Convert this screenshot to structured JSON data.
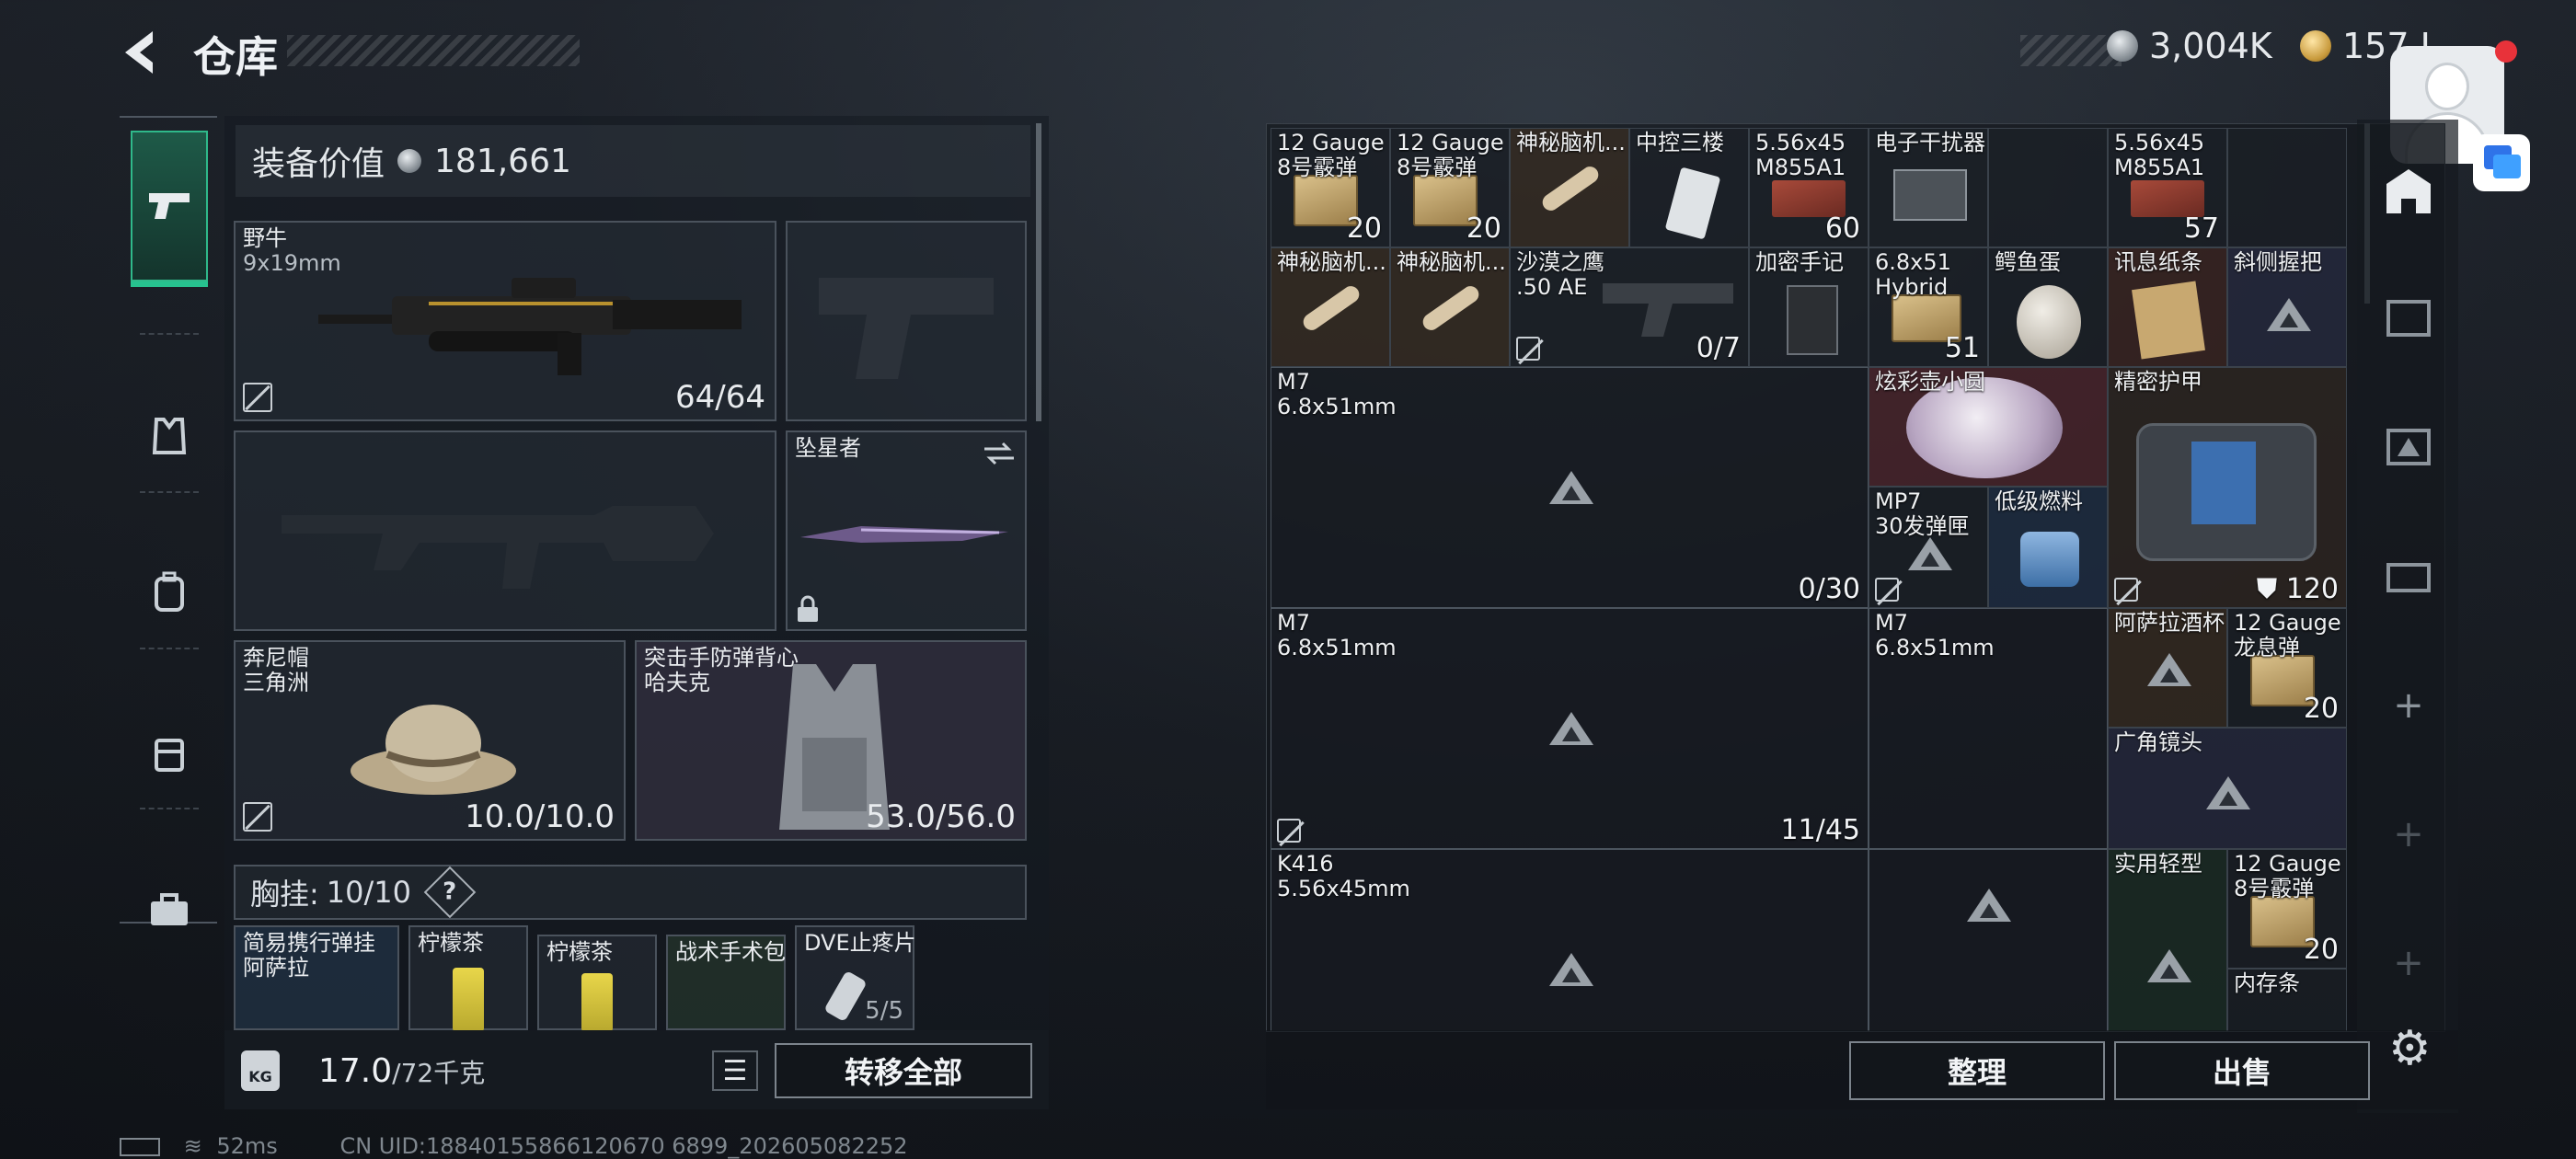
{
  "header": {
    "title": "仓库",
    "silver": "3,004K",
    "gold": "157 I"
  },
  "equipment": {
    "value_label": "装备价值",
    "value": "181,661",
    "primary": {
      "name": "野牛",
      "caliber": "9x19mm",
      "ammo": "64/64"
    },
    "melee": {
      "name": "坠星者"
    },
    "helmet": {
      "name": "奔尼帽\n三角洲",
      "durability": "10.0/10.0"
    },
    "armor": {
      "name": "突击手防弹背心\n哈夫克",
      "durability": "53.0/56.0"
    },
    "chest_label": "胸挂:",
    "chest_value": "10/10",
    "chest_help": "?",
    "chest_items": [
      {
        "name": "简易携行弹挂\n阿萨拉"
      },
      {
        "name": "柠檬茶"
      },
      {
        "name": "柠檬茶"
      },
      {
        "name": "战术手术包"
      },
      {
        "name": "DVE止疼片",
        "count": "5/5"
      }
    ]
  },
  "footer": {
    "weight": "17.0",
    "weight_max": "/72千克",
    "kg_icon": "KG",
    "transfer_all": "转移全部",
    "organize": "整理",
    "sell": "出售"
  },
  "status": {
    "ping": "52ms",
    "uid": "CN UID:18840155866120670 6899_202605082252"
  },
  "grid": {
    "row1": [
      {
        "name": "12 Gauge\n8号霰弹",
        "count": "20"
      },
      {
        "name": "12 Gauge\n8号霰弹",
        "count": "20"
      },
      {
        "name": "神秘脑机..."
      },
      {
        "name": "中控三楼"
      },
      {
        "name": "5.56x45\nM855A1",
        "count": "60"
      },
      {
        "name": "电子干扰器"
      },
      {
        "name": "5.56x45\nM855A1",
        "count": "57"
      }
    ],
    "row2": [
      {
        "name": "神秘脑机..."
      },
      {
        "name": "神秘脑机..."
      },
      {
        "name": "沙漠之鹰\n.50 AE",
        "count": "0/7"
      },
      {
        "name": "加密手记"
      },
      {
        "name": "6.8x51\nHybrid",
        "count": "51"
      },
      {
        "name": "鳄鱼蛋"
      },
      {
        "name": "讯息纸条"
      },
      {
        "name": "斜侧握把"
      }
    ],
    "m7_a": {
      "name": "M7\n6.8x51mm",
      "count": "0/30"
    },
    "xuancai": {
      "name": "炫彩壶小圆"
    },
    "armor_bag": {
      "name": "精密护甲",
      "count": "120"
    },
    "mp7_mag": {
      "name": "MP7\n30发弹匣"
    },
    "fuel": {
      "name": "低级燃料"
    },
    "m7_b": {
      "name": "M7\n6.8x51mm",
      "count": "11/45"
    },
    "m7_c": {
      "name": "M7\n6.8x51mm"
    },
    "cup": {
      "name": "阿萨拉酒杯"
    },
    "dragon": {
      "name": "12 Gauge\n龙息弹",
      "count": "20"
    },
    "wide_lens": {
      "name": "广角镜头"
    },
    "k416": {
      "name": "K416\n5.56x45mm"
    },
    "light_armor": {
      "name": "实用轻型"
    },
    "gauge_c": {
      "name": "12 Gauge\n8号霰弹",
      "count": "20"
    },
    "memory": {
      "name": "内存条"
    }
  }
}
